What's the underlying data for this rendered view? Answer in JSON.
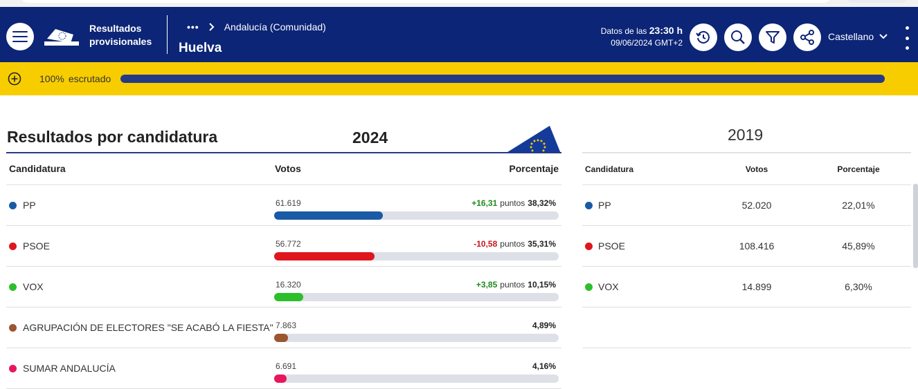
{
  "header": {
    "title_line1": "Resultados",
    "title_line2": "provisionales",
    "breadcrumb_more": "•••",
    "breadcrumb_parent": "Andalucía (Comunidad)",
    "region": "Huelva",
    "datos_prefix": "Datos de las",
    "datos_time": "23:30 h",
    "datos_date": "09/06/2024 GMT+2",
    "language": "Castellano",
    "icons": [
      "menu-icon",
      "ballot-box-logo",
      "history-icon",
      "search-icon",
      "filter-icon",
      "share-icon",
      "chevron-down-icon",
      "more-vertical-icon"
    ]
  },
  "scrutiny": {
    "percent_text": "100%",
    "label": "escrutado",
    "fraction": 1.0
  },
  "colors": {
    "header_bg": "#0c2577",
    "progress_bg": "#f7cd00",
    "progress_fill": "#243a87",
    "up": "#1d8a1d",
    "down": "#c5161d"
  },
  "results_2024": {
    "title": "Resultados por candidatura",
    "year": "2024",
    "col_candidatura": "Candidatura",
    "col_votos": "Votos",
    "col_porcentaje": "Porcentaje",
    "points_word": "puntos",
    "rows": [
      {
        "name": "PP",
        "votes": "61.619",
        "delta": "+16,31",
        "delta_dir": "up",
        "percent": "38,32%",
        "share": 0.3832,
        "color": "#1a5aa6"
      },
      {
        "name": "PSOE",
        "votes": "56.772",
        "delta": "-10,58",
        "delta_dir": "down",
        "percent": "35,31%",
        "share": 0.3531,
        "color": "#e0161e"
      },
      {
        "name": "VOX",
        "votes": "16.320",
        "delta": "+3,85",
        "delta_dir": "up",
        "percent": "10,15%",
        "share": 0.1015,
        "color": "#2bbf2b"
      },
      {
        "name": "AGRUPACIÓN DE ELECTORES \"SE ACABÓ LA FIESTA\"",
        "votes": "7.863",
        "delta": "",
        "delta_dir": "",
        "percent": "4,89%",
        "share": 0.0489,
        "color": "#9b5530"
      },
      {
        "name": "SUMAR ANDALUCÍA",
        "votes": "6.691",
        "delta": "",
        "delta_dir": "",
        "percent": "4,16%",
        "share": 0.0416,
        "color": "#e8175d"
      }
    ]
  },
  "results_2019": {
    "year": "2019",
    "col_candidatura": "Candidatura",
    "col_votos": "Votos",
    "col_porcentaje": "Porcentaje",
    "rows": [
      {
        "name": "PP",
        "votes": "52.020",
        "percent": "22,01%",
        "color": "#1a5aa6"
      },
      {
        "name": "PSOE",
        "votes": "108.416",
        "percent": "45,89%",
        "color": "#e0161e"
      },
      {
        "name": "VOX",
        "votes": "14.899",
        "percent": "6,30%",
        "color": "#2bbf2b"
      }
    ]
  }
}
